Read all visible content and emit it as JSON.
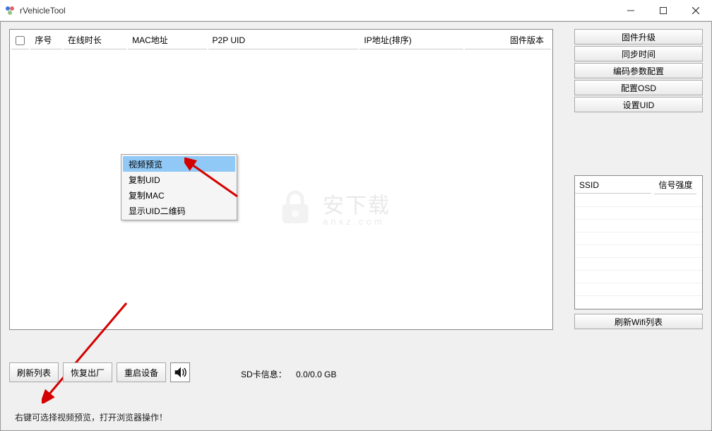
{
  "window": {
    "title": "rVehicleTool"
  },
  "table": {
    "columns": {
      "idx": "序号",
      "online": "在线时长",
      "mac": "MAC地址",
      "p2p": "P2P UID",
      "ip": "IP地址(排序)",
      "fw": "固件版本"
    }
  },
  "sideButtons": {
    "firmwareUpgrade": "固件升级",
    "syncTime": "同步时间",
    "encodeConfig": "编码参数配置",
    "osdConfig": "配置OSD",
    "setUid": "设置UID"
  },
  "wifi": {
    "ssid": "SSID",
    "signal": "信号强度",
    "refresh": "刷新Wifi列表"
  },
  "bottom": {
    "refreshList": "刷新列表",
    "factoryReset": "恢复出厂",
    "reboot": "重启设备"
  },
  "sd": {
    "label": "SD卡信息：",
    "value": "0.0/0.0 GB"
  },
  "hint": "右键可选择视频预览，打开浏览器操作！",
  "contextMenu": {
    "videoPreview": "视频预览",
    "copyUid": "复制UID",
    "copyMac": "复制MAC",
    "showQr": "显示UID二维码"
  },
  "watermark": {
    "main": "安下载",
    "sub": "anxz.com"
  }
}
